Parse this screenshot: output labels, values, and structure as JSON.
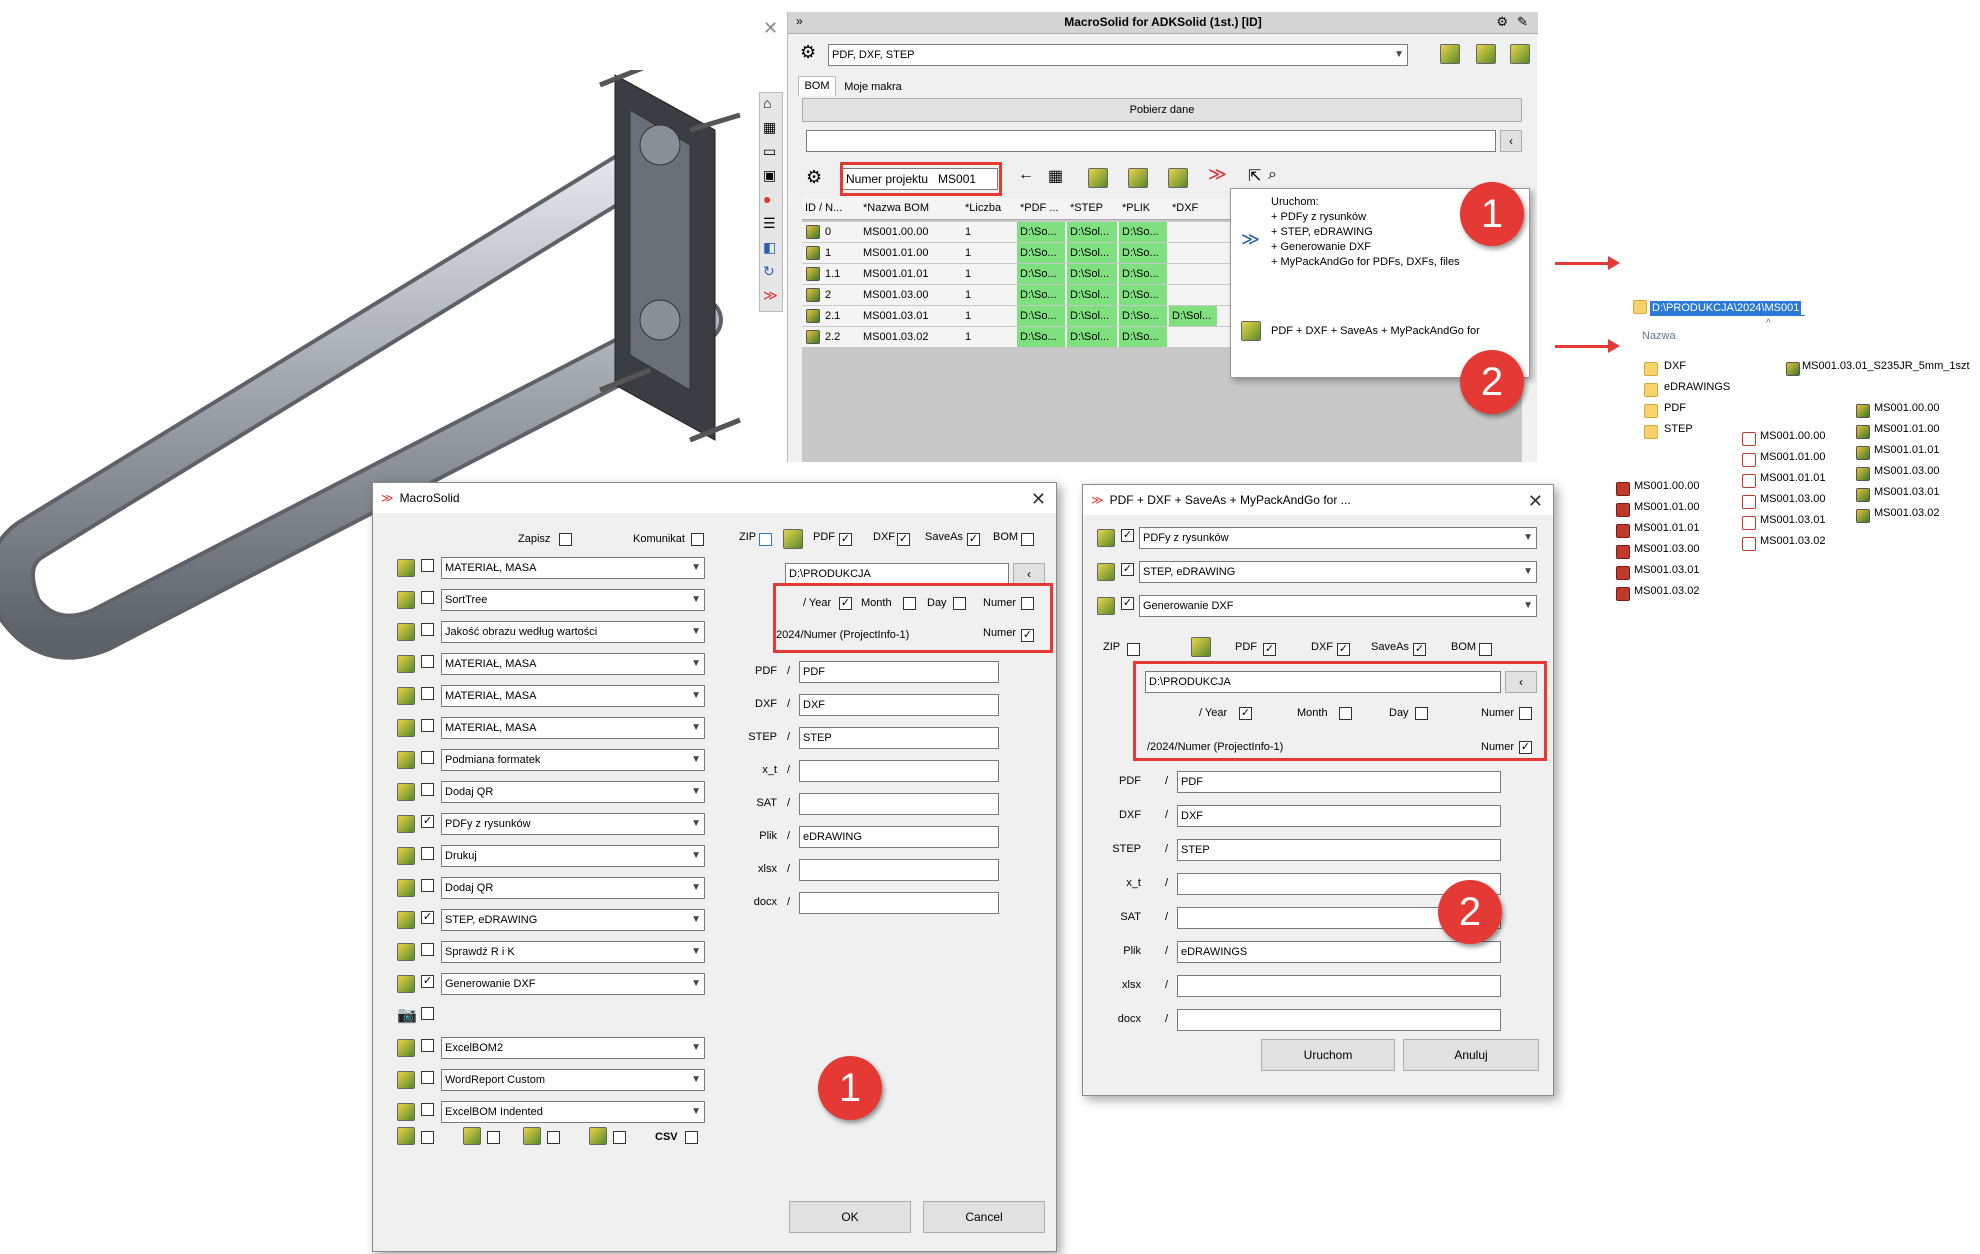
{
  "main_window": {
    "title": "MacroSolid for ADKSolid (1st.) [ID]",
    "profile": "PDF, DXF, STEP",
    "tabs": [
      "BOM",
      "Moje makra"
    ],
    "pobierz": "Pobierz dane",
    "project_label": "Numer projektu",
    "project_value": "MS001",
    "columns": [
      "ID / N...",
      "*Nazwa BOM",
      "*Liczba",
      "*PDF ...",
      "*STEP",
      "*PLIK",
      "*DXF"
    ],
    "rows": [
      {
        "id": "0",
        "name": "MS001.00.00",
        "qty": "1",
        "pdf": "D:\\So...",
        "step": "D:\\Sol...",
        "plik": "D:\\So...",
        "dxf": ""
      },
      {
        "id": "1",
        "name": "MS001.01.00",
        "qty": "1",
        "pdf": "D:\\So...",
        "step": "D:\\Sol...",
        "plik": "D:\\So...",
        "dxf": ""
      },
      {
        "id": "1.1",
        "name": "MS001.01.01",
        "qty": "1",
        "pdf": "D:\\So...",
        "step": "D:\\Sol...",
        "plik": "D:\\So...",
        "dxf": ""
      },
      {
        "id": "2",
        "name": "MS001.03.00",
        "qty": "1",
        "pdf": "D:\\So...",
        "step": "D:\\Sol...",
        "plik": "D:\\So...",
        "dxf": ""
      },
      {
        "id": "2.1",
        "name": "MS001.03.01",
        "qty": "1",
        "pdf": "D:\\So...",
        "step": "D:\\Sol...",
        "plik": "D:\\So...",
        "dxf": "D:\\Sol..."
      },
      {
        "id": "2.2",
        "name": "MS001.03.02",
        "qty": "1",
        "pdf": "D:\\So...",
        "step": "D:\\Sol...",
        "plik": "D:\\So...",
        "dxf": ""
      }
    ]
  },
  "popup": {
    "item1_lines": [
      "Uruchom:",
      "+ PDFy z rysunków",
      "+ STEP, eDRAWING",
      "+ Generowanie DXF",
      "+ MyPackAndGo for PDFs, DXFs, files"
    ],
    "item2": "PDF + DXF + SaveAs + MyPackAndGo for"
  },
  "badges": [
    "1",
    "2",
    "1",
    "2"
  ],
  "explorer": {
    "path": "D:\\PRODUKCJA\\2024\\MS001",
    "header": "Nazwa",
    "folders": [
      "DXF",
      "eDRAWINGS",
      "PDF",
      "STEP"
    ],
    "top_file": "MS001.03.01_S235JR_5mm_1szt",
    "drw_files": [
      "MS001.00.00",
      "MS001.01.00",
      "MS001.01.01",
      "MS001.03.00",
      "MS001.03.01",
      "MS001.03.02"
    ],
    "pdf_files": [
      "MS001.00.00",
      "MS001.01.00",
      "MS001.01.01",
      "MS001.03.00",
      "MS001.03.01",
      "MS001.03.02"
    ],
    "asm_files": [
      "MS001.00.00",
      "MS001.01.00",
      "MS001.01.01",
      "MS001.03.00",
      "MS001.03.01",
      "MS001.03.02"
    ]
  },
  "dlg1": {
    "title": "MacroSolid",
    "zapisz": "Zapisz",
    "komunikat": "Komunikat",
    "zip": "ZIP",
    "pdf": "PDF",
    "dxf": "DXF",
    "saveas": "SaveAs",
    "bom": "BOM",
    "macros": [
      {
        "label": "MATERIAŁ, MASA",
        "checked": false
      },
      {
        "label": "SortTree",
        "checked": false
      },
      {
        "label": "Jakość obrazu według wartości",
        "checked": false
      },
      {
        "label": "MATERIAŁ, MASA",
        "checked": false
      },
      {
        "label": "MATERIAŁ, MASA",
        "checked": false
      },
      {
        "label": "MATERIAŁ, MASA",
        "checked": false
      },
      {
        "label": "Podmiana formatek",
        "checked": false
      },
      {
        "label": "Dodaj QR",
        "checked": false
      },
      {
        "label": "PDFy z rysunków",
        "checked": true
      },
      {
        "label": "Drukuj",
        "checked": false
      },
      {
        "label": "Dodaj QR",
        "checked": false
      },
      {
        "label": "STEP, eDRAWING",
        "checked": true
      },
      {
        "label": "Sprawdź R i K",
        "checked": false
      },
      {
        "label": "Generowanie DXF",
        "checked": true
      }
    ],
    "macros2": [
      "ExcelBOM2",
      "WordReport Custom",
      "ExcelBOM Indented"
    ],
    "path": "D:\\PRODUKCJA",
    "year": "/ Year",
    "month": "Month",
    "day": "Day",
    "numer": "Numer",
    "result": "/2024/Numer (ProjectInfo-1)",
    "fields": [
      {
        "label": "PDF",
        "value": "PDF"
      },
      {
        "label": "DXF",
        "value": "DXF"
      },
      {
        "label": "STEP",
        "value": "STEP"
      },
      {
        "label": "x_t",
        "value": ""
      },
      {
        "label": "SAT",
        "value": ""
      },
      {
        "label": "Plik",
        "value": "eDRAWING"
      },
      {
        "label": "xlsx",
        "value": ""
      },
      {
        "label": "docx",
        "value": ""
      }
    ],
    "slash": "/",
    "csv": "CSV",
    "ok": "OK",
    "cancel": "Cancel"
  },
  "dlg2": {
    "title": "PDF + DXF + SaveAs + MyPackAndGo for ...",
    "macros": [
      "PDFy z rysunków",
      "STEP, eDRAWING",
      "Generowanie DXF"
    ],
    "zip": "ZIP",
    "pdf": "PDF",
    "dxf": "DXF",
    "saveas": "SaveAs",
    "bom": "BOM",
    "path": "D:\\PRODUKCJA",
    "year": "/ Year",
    "month": "Month",
    "day": "Day",
    "numer": "Numer",
    "result": "/2024/Numer (ProjectInfo-1)",
    "fields": [
      {
        "label": "PDF",
        "value": "PDF"
      },
      {
        "label": "DXF",
        "value": "DXF"
      },
      {
        "label": "STEP",
        "value": "STEP"
      },
      {
        "label": "x_t",
        "value": ""
      },
      {
        "label": "SAT",
        "value": ""
      },
      {
        "label": "Plik",
        "value": "eDRAWINGS"
      },
      {
        "label": "xlsx",
        "value": ""
      },
      {
        "label": "docx",
        "value": ""
      }
    ],
    "slash": "/",
    "run": "Uruchom",
    "cancel": "Anuluj"
  }
}
